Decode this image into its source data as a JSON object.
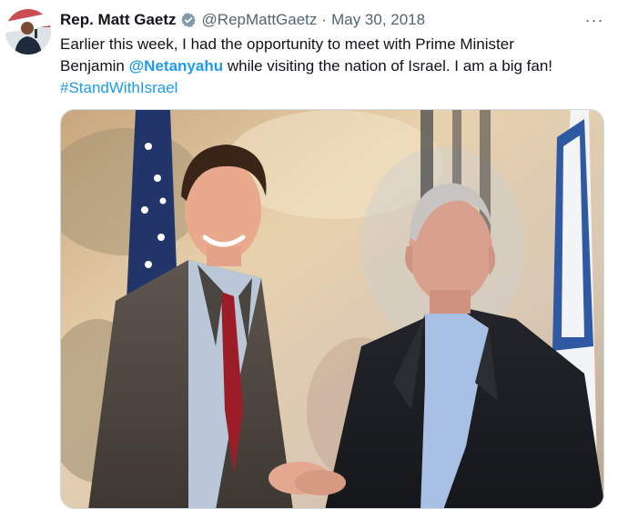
{
  "tweet": {
    "author": {
      "display_name": "Rep. Matt Gaetz",
      "handle": "@RepMattGaetz",
      "verified_icon": "verified-badge-icon",
      "avatar_icon": "avatar"
    },
    "separator": "·",
    "date": "May 30, 2018",
    "more_icon": "more-options-icon",
    "more_label": "···",
    "text": {
      "line1": "Earlier this week, I had the opportunity to meet with Prime Minister",
      "line2_prefix": "Benjamin ",
      "mention": "@Netanyahu",
      "line2_suffix": " while visiting the nation of Israel. I am a big fan!",
      "hashtag": "#StandWithIsrael"
    },
    "media": {
      "kind": "photo",
      "description_icon": "tweet-photo"
    }
  },
  "colors": {
    "link": "#1d9bf0",
    "secondary_text": "#536471",
    "primary_text": "#0f1419",
    "verified_badge": "#829aab"
  }
}
